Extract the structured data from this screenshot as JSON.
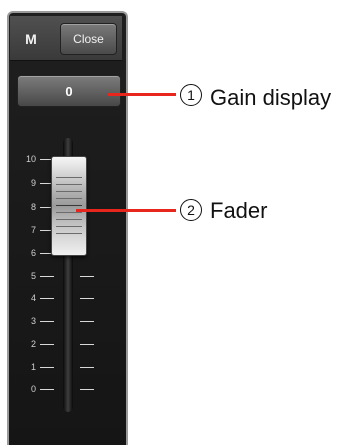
{
  "panel": {
    "m_label": "M",
    "close_label": "Close",
    "gain_value": "0"
  },
  "scale": {
    "ticks": [
      "10",
      "9",
      "8",
      "7",
      "6",
      "5",
      "4",
      "3",
      "2",
      "1",
      "0"
    ]
  },
  "callouts": [
    {
      "number": "1",
      "label": "Gain display"
    },
    {
      "number": "2",
      "label": "Fader"
    }
  ],
  "colors": {
    "panel_bg": "#1a1a1a",
    "leader": "#e8261e"
  }
}
